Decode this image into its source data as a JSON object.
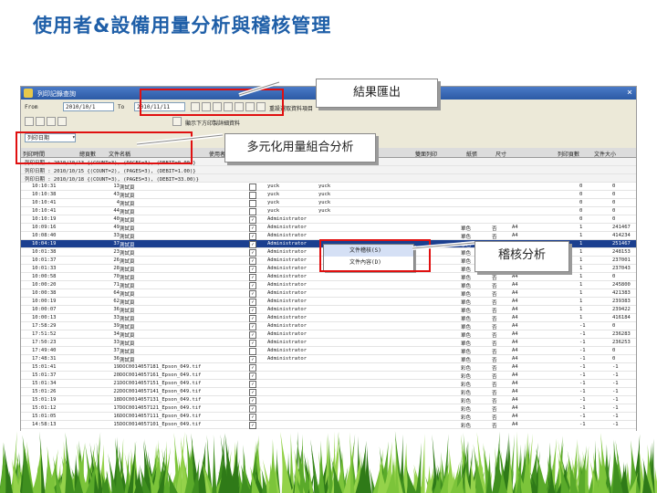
{
  "slide_title": "使用者&設備用量分析與稽核管理",
  "callouts": {
    "export": "結果匯出",
    "multi_analysis": "多元化用量組合分析",
    "audit": "稽核分析"
  },
  "app": {
    "title": "列印記錄查詢",
    "date_from_label": "From",
    "date_from": "2010/10/1",
    "date_to_label": "To",
    "date_to": "2010/11/11",
    "include_deleted_label": "重設選取資料項目",
    "show_summary_label": "顯示下方印製詳細資料",
    "group_select": "列印日期",
    "close_glyph": "×"
  },
  "columns": [
    "列印時間",
    "總頁數",
    "文件名稱",
    "",
    "使用者",
    "",
    "",
    "色彩",
    "雙面列印",
    "紙張",
    "尺寸",
    "列印頁數",
    "文件大小"
  ],
  "summary_rows": [
    "列印日期 : 2010/10/13 {(COUNT=3), (PAGES=3), (DEBIT=0.00)}",
    "列印日期 : 2010/10/15 {(COUNT=2), (PAGES=3), (DEBIT=1.00)}",
    "列印日期 : 2010/10/18 {(COUNT=3), (PAGES=3), (DEBIT=33.00)}"
  ],
  "rows": [
    {
      "time": "10:10:31",
      "pages": "13",
      "doc": "測試頁",
      "chk": false,
      "user": "yuck",
      "host": "yuck",
      "color": "",
      "duplex": "",
      "paper": "",
      "size": "",
      "pp": "0",
      "bytes": "0"
    },
    {
      "time": "10:10:38",
      "pages": "43",
      "doc": "測試頁",
      "chk": false,
      "user": "yuck",
      "host": "yuck",
      "color": "",
      "duplex": "",
      "paper": "",
      "size": "",
      "pp": "0",
      "bytes": "0"
    },
    {
      "time": "10:10:41",
      "pages": "4",
      "doc": "測試頁",
      "chk": false,
      "user": "yuck",
      "host": "yuck",
      "color": "",
      "duplex": "",
      "paper": "",
      "size": "",
      "pp": "0",
      "bytes": "0"
    },
    {
      "time": "10:10:41",
      "pages": "44",
      "doc": "測試頁",
      "chk": false,
      "user": "yuck",
      "host": "yuck",
      "color": "",
      "duplex": "",
      "paper": "",
      "size": "",
      "pp": "0",
      "bytes": "0"
    },
    {
      "time": "10:10:19",
      "pages": "40",
      "doc": "測試頁",
      "chk": true,
      "user": "Administrator",
      "host": "",
      "color": "",
      "duplex": "",
      "paper": "",
      "size": "",
      "pp": "0",
      "bytes": "0"
    },
    {
      "time": "10:09:16",
      "pages": "49",
      "doc": "測試頁",
      "chk": true,
      "user": "Administrator",
      "host": "",
      "color": "單色",
      "duplex": "否",
      "paper": "A4",
      "size": "",
      "pp": "1",
      "bytes": "241467"
    },
    {
      "time": "10:08:40",
      "pages": "33",
      "doc": "測試頁",
      "chk": true,
      "user": "Administrator",
      "host": "",
      "color": "單色",
      "duplex": "否",
      "paper": "A4",
      "size": "",
      "pp": "1",
      "bytes": "414234"
    },
    {
      "time": "10:04:19",
      "pages": "37",
      "doc": "測試頁",
      "chk": true,
      "user": "Administrator",
      "host": "",
      "color": "單色",
      "duplex": "否",
      "paper": "A4",
      "size": "",
      "pp": "1",
      "bytes": "251467",
      "sel": true
    },
    {
      "time": "10:01:38",
      "pages": "23",
      "doc": "測試頁",
      "chk": true,
      "user": "Administrator",
      "host": "",
      "color": "單色",
      "duplex": "否",
      "paper": "A4",
      "size": "",
      "pp": "1",
      "bytes": "248153"
    },
    {
      "time": "10:01:37",
      "pages": "26",
      "doc": "測試頁",
      "chk": true,
      "user": "Administrator",
      "host": "",
      "color": "單色",
      "duplex": "否",
      "paper": "A4",
      "size": "",
      "pp": "1",
      "bytes": "237001"
    },
    {
      "time": "10:01:33",
      "pages": "28",
      "doc": "測試頁",
      "chk": true,
      "user": "Administrator",
      "host": "",
      "color": "單色",
      "duplex": "否",
      "paper": "A4",
      "size": "",
      "pp": "1",
      "bytes": "237043"
    },
    {
      "time": "10:00:58",
      "pages": "70",
      "doc": "測試頁",
      "chk": true,
      "user": "Administrator",
      "host": "",
      "color": "單色",
      "duplex": "否",
      "paper": "A4",
      "size": "",
      "pp": "1",
      "bytes": "0"
    },
    {
      "time": "10:00:20",
      "pages": "71",
      "doc": "測試頁",
      "chk": true,
      "user": "Administrator",
      "host": "",
      "color": "單色",
      "duplex": "否",
      "paper": "A4",
      "size": "",
      "pp": "1",
      "bytes": "245800"
    },
    {
      "time": "10:00:38",
      "pages": "64",
      "doc": "測試頁",
      "chk": true,
      "user": "Administrator",
      "host": "",
      "color": "單色",
      "duplex": "否",
      "paper": "A4",
      "size": "",
      "pp": "1",
      "bytes": "421383"
    },
    {
      "time": "10:00:19",
      "pages": "62",
      "doc": "測試頁",
      "chk": true,
      "user": "Administrator",
      "host": "",
      "color": "單色",
      "duplex": "否",
      "paper": "A4",
      "size": "",
      "pp": "1",
      "bytes": "239383"
    },
    {
      "time": "10:00:07",
      "pages": "36",
      "doc": "測試頁",
      "chk": true,
      "user": "Administrator",
      "host": "",
      "color": "單色",
      "duplex": "否",
      "paper": "A4",
      "size": "",
      "pp": "1",
      "bytes": "239422"
    },
    {
      "time": "10:00:13",
      "pages": "33",
      "doc": "測試頁",
      "chk": true,
      "user": "Administrator",
      "host": "",
      "color": "單色",
      "duplex": "否",
      "paper": "A4",
      "size": "",
      "pp": "1",
      "bytes": "416184"
    },
    {
      "time": "17:58:29",
      "pages": "39",
      "doc": "測試頁",
      "chk": true,
      "user": "Administrator",
      "host": "",
      "color": "單色",
      "duplex": "否",
      "paper": "A4",
      "size": "",
      "pp": "-1",
      "bytes": "0"
    },
    {
      "time": "17:51:52",
      "pages": "34",
      "doc": "測試頁",
      "chk": true,
      "user": "Administrator",
      "host": "",
      "color": "單色",
      "duplex": "否",
      "paper": "A4",
      "size": "",
      "pp": "-1",
      "bytes": "236283"
    },
    {
      "time": "17:50:23",
      "pages": "33",
      "doc": "測試頁",
      "chk": true,
      "user": "Administrator",
      "host": "",
      "color": "單色",
      "duplex": "否",
      "paper": "A4",
      "size": "",
      "pp": "-1",
      "bytes": "236253"
    },
    {
      "time": "17:49:40",
      "pages": "37",
      "doc": "測試頁",
      "chk": false,
      "user": "Administrator",
      "host": "",
      "color": "單色",
      "duplex": "否",
      "paper": "A4",
      "size": "",
      "pp": "-1",
      "bytes": "0"
    },
    {
      "time": "17:48:31",
      "pages": "36",
      "doc": "測試頁",
      "chk": true,
      "user": "Administrator",
      "host": "",
      "color": "單色",
      "duplex": "否",
      "paper": "A4",
      "size": "",
      "pp": "-1",
      "bytes": "0"
    },
    {
      "time": "15:01:41",
      "pages": "19",
      "doc": "DOC0014057181_Epson_049.tif",
      "chk": true,
      "user": "",
      "host": "",
      "color": "彩色",
      "duplex": "否",
      "paper": "A4",
      "size": "",
      "pp": "-1",
      "bytes": "-1"
    },
    {
      "time": "15:01:37",
      "pages": "20",
      "doc": "DOC0014057161_Epson_049.tif",
      "chk": true,
      "user": "",
      "host": "",
      "color": "彩色",
      "duplex": "否",
      "paper": "A4",
      "size": "",
      "pp": "-1",
      "bytes": "-1"
    },
    {
      "time": "15:01:34",
      "pages": "21",
      "doc": "DOC0014057151_Epson_049.tif",
      "chk": true,
      "user": "",
      "host": "",
      "color": "彩色",
      "duplex": "否",
      "paper": "A4",
      "size": "",
      "pp": "-1",
      "bytes": "-1"
    },
    {
      "time": "15:01:26",
      "pages": "22",
      "doc": "DOC0014057141_Epson_049.tif",
      "chk": true,
      "user": "",
      "host": "",
      "color": "彩色",
      "duplex": "否",
      "paper": "A4",
      "size": "",
      "pp": "-1",
      "bytes": "-1"
    },
    {
      "time": "15:01:19",
      "pages": "18",
      "doc": "DOC0014057131_Epson_049.tif",
      "chk": true,
      "user": "",
      "host": "",
      "color": "彩色",
      "duplex": "否",
      "paper": "A4",
      "size": "",
      "pp": "-1",
      "bytes": "-1"
    },
    {
      "time": "15:01:12",
      "pages": "17",
      "doc": "DOC0014057121_Epson_049.tif",
      "chk": true,
      "user": "",
      "host": "",
      "color": "彩色",
      "duplex": "否",
      "paper": "A4",
      "size": "",
      "pp": "-1",
      "bytes": "-1"
    },
    {
      "time": "15:01:05",
      "pages": "16",
      "doc": "DOC0014057111_Epson_049.tif",
      "chk": true,
      "user": "",
      "host": "",
      "color": "彩色",
      "duplex": "否",
      "paper": "A4",
      "size": "",
      "pp": "-1",
      "bytes": "-1"
    },
    {
      "time": "14:58:13",
      "pages": "15",
      "doc": "DOC0014057101_Epson_049.tif",
      "chk": true,
      "user": "",
      "host": "",
      "color": "彩色",
      "duplex": "否",
      "paper": "A4",
      "size": "",
      "pp": "-1",
      "bytes": "-1"
    }
  ],
  "context_menu": [
    "文件稽核(S)",
    "文件內容(D)"
  ],
  "colors": {
    "title": "#1f5fa8",
    "highlight_box": "#e01010",
    "selection": "#1b3f8f"
  }
}
